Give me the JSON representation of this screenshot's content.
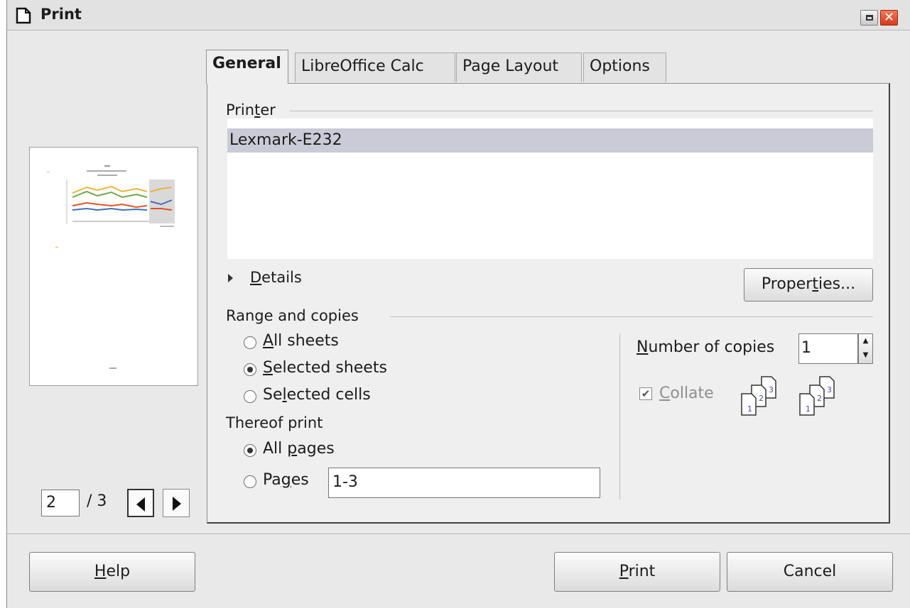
{
  "dialog": {
    "title": "Print"
  },
  "tabs": [
    {
      "label": "General",
      "active": true
    },
    {
      "label": "LibreOffice Calc",
      "active": false
    },
    {
      "label": "Page Layout",
      "active": false
    },
    {
      "label": "Options",
      "active": false
    }
  ],
  "printer": {
    "section_pre": "Prin",
    "section_mn": "t",
    "section_post": "er",
    "selected": "Lexmark-E232",
    "details_mn": "D",
    "details_post": "etails",
    "properties_pre": "Proper",
    "properties_mn": "t",
    "properties_post": "ies..."
  },
  "range": {
    "section": "Range and copies",
    "all_mn": "A",
    "all_post": "ll sheets",
    "selected_mn": "S",
    "selected_post": "elected sheets",
    "cells_pre": "Se",
    "cells_mn": "l",
    "cells_post": "ected cells",
    "selection": "Selected sheets"
  },
  "thereof": {
    "section": "Thereof print",
    "allpages_pre": "All ",
    "allpages_mn": "p",
    "allpages_post": "ages",
    "pages_pre": "Pa",
    "pages_mn": "g",
    "pages_post": "es",
    "pages_value": "1-3",
    "selection": "All pages"
  },
  "copies": {
    "label_mn": "N",
    "label_post": "umber of copies",
    "value": "1",
    "collate_mn": "C",
    "collate_post": "ollate",
    "collate_checked": true,
    "page_numbers": [
      "1",
      "2",
      "3"
    ]
  },
  "preview": {
    "current_page": "2",
    "total": "/ 3"
  },
  "footer": {
    "help_mn": "H",
    "help_post": "elp",
    "print_mn": "P",
    "print_post": "rint",
    "cancel": "Cancel"
  },
  "colors": {
    "selection": "#cacbd7",
    "close_button": "#d6391a",
    "panel": "#efefef",
    "window": "#e9e9e9"
  },
  "icons": {
    "title": "document-icon",
    "restore": "restore-icon",
    "close": "close-icon"
  }
}
